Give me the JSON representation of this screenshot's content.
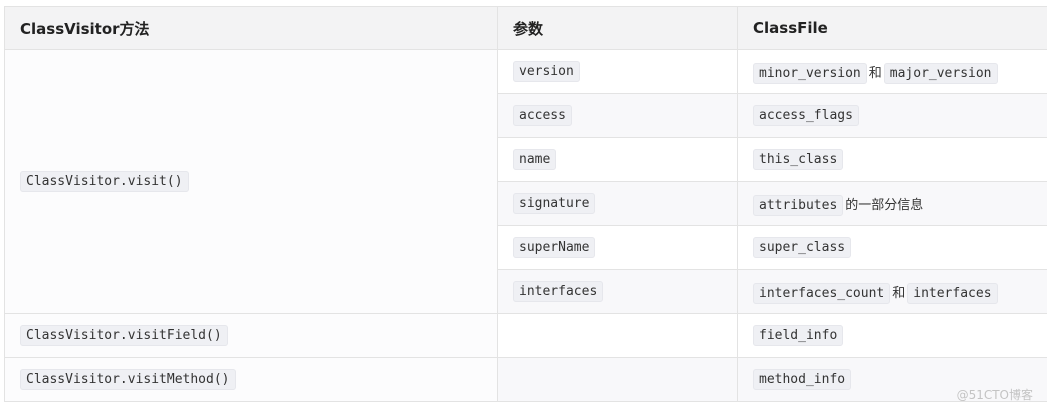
{
  "headers": [
    "ClassVisitor方法",
    "参数",
    "ClassFile"
  ],
  "rows": [
    {
      "method": "ClassVisitor.visit()",
      "param": "version",
      "classfile": [
        {
          "code": "minor_version"
        },
        {
          "text": "和"
        },
        {
          "code": "major_version"
        }
      ]
    },
    {
      "param": "access",
      "classfile": [
        {
          "code": "access_flags"
        }
      ]
    },
    {
      "param": "name",
      "classfile": [
        {
          "code": "this_class"
        }
      ]
    },
    {
      "param": "signature",
      "classfile": [
        {
          "code": "attributes"
        },
        {
          "text": "的一部分信息"
        }
      ]
    },
    {
      "param": "superName",
      "classfile": [
        {
          "code": "super_class"
        }
      ]
    },
    {
      "param": "interfaces",
      "classfile": [
        {
          "code": "interfaces_count"
        },
        {
          "text": "和"
        },
        {
          "code": "interfaces"
        }
      ]
    },
    {
      "method": "ClassVisitor.visitField()",
      "param": "",
      "classfile": [
        {
          "code": "field_info"
        }
      ]
    },
    {
      "method": "ClassVisitor.visitMethod()",
      "param": "",
      "classfile": [
        {
          "code": "method_info"
        }
      ]
    }
  ],
  "watermark": "@51CTO博客"
}
